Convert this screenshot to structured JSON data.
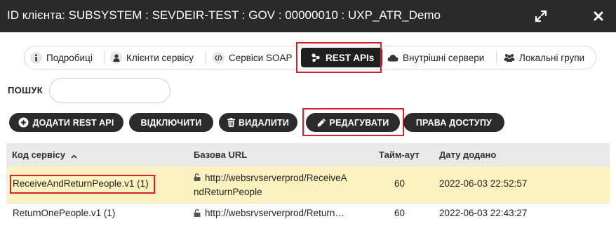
{
  "titlebar": {
    "title": "ID клієнта: SUBSYSTEM : SEVDEIR-TEST : GOV : 00000010 : UXP_ATR_Demo",
    "expand_icon": "expand-icon",
    "close_icon": "close-icon"
  },
  "tabs": [
    {
      "label": "Подробиці",
      "icon": "info-icon"
    },
    {
      "label": "Клієнти сервісу",
      "icon": "user-icon"
    },
    {
      "label": "Сервіси SOAP",
      "icon": "code-icon"
    },
    {
      "label": "REST APIs",
      "icon": "network-icon",
      "active": true
    },
    {
      "label": "Внутрішні сервери",
      "icon": "cloud-icon"
    },
    {
      "label": "Локальні групи",
      "icon": "group-icon"
    }
  ],
  "search": {
    "label": "ПОШУК",
    "value": "",
    "placeholder": ""
  },
  "actions": {
    "add": "ДОДАТИ REST API",
    "disable": "ВІДКЛЮЧИТИ",
    "delete": "ВИДАЛИТИ",
    "edit": "РЕДАГУВАТИ",
    "access": "ПРАВА ДОСТУПУ"
  },
  "table": {
    "columns": {
      "code": "Код сервісу",
      "url": "Базова URL",
      "timeout": "Тайм-аут",
      "date": "Дату додано"
    },
    "sort_icon": "caret-up-icon",
    "rows": [
      {
        "code": "ReceiveAndReturnPeople.v1 (1)",
        "url_line1": "http://websrvserverprod/ReceiveA",
        "url_line2": "ndReturnPeople",
        "timeout": "60",
        "date": "2022-06-03 22:52:57",
        "selected": true
      },
      {
        "code": "ReturnOnePeople.v1 (1)",
        "url_line1": "http://websrvserverprod/Return…",
        "timeout": "60",
        "date": "2022-06-03 22:43:27",
        "selected": false
      }
    ]
  },
  "colors": {
    "titlebar_bg": "#2a2a2a",
    "button_bg": "#2b2b2b",
    "highlight": "#d8202a",
    "selected_row": "#fbf2bf"
  }
}
